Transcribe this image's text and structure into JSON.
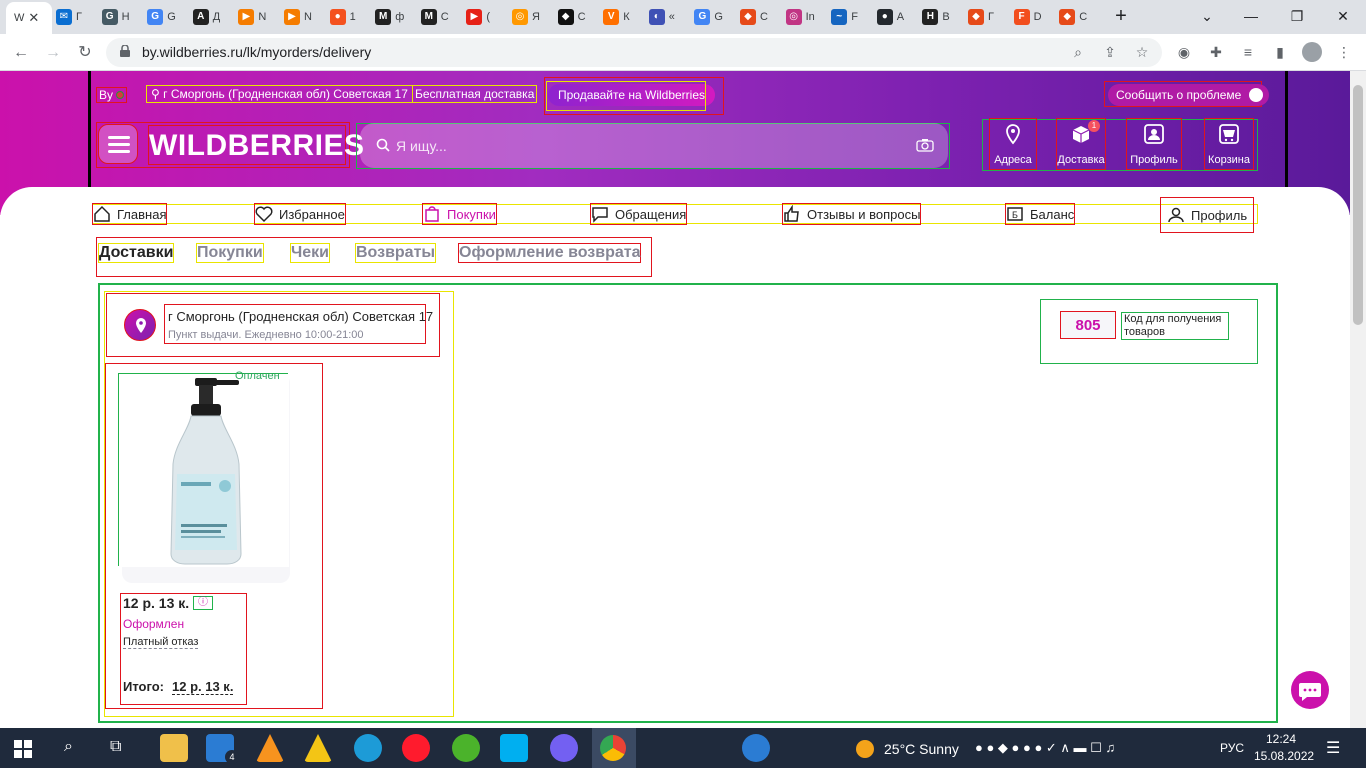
{
  "browser": {
    "tabs": [
      {
        "title": "W",
        "color": "#cb11ab",
        "glyph": "W"
      },
      {
        "title": "Г",
        "color": "#0a6ed1",
        "glyph": "✉"
      },
      {
        "title": "Н",
        "color": "#455a64",
        "glyph": "G"
      },
      {
        "title": "G",
        "color": "#4285f4",
        "glyph": "G"
      },
      {
        "title": "Д",
        "color": "#222222",
        "glyph": "A"
      },
      {
        "title": "N",
        "color": "#f57c00",
        "glyph": "▶"
      },
      {
        "title": "N",
        "color": "#f57c00",
        "glyph": "▶"
      },
      {
        "title": "1",
        "color": "#f4511e",
        "glyph": "●"
      },
      {
        "title": "ф",
        "color": "#222222",
        "glyph": "M"
      },
      {
        "title": "С",
        "color": "#222222",
        "glyph": "M"
      },
      {
        "title": "(",
        "color": "#e62117",
        "glyph": "▶"
      },
      {
        "title": "Я",
        "color": "#ff9800",
        "glyph": "◎"
      },
      {
        "title": "С",
        "color": "#111111",
        "glyph": "◆"
      },
      {
        "title": "К",
        "color": "#ff6f00",
        "glyph": "V"
      },
      {
        "title": "«",
        "color": "#3f51b5",
        "glyph": "◐"
      },
      {
        "title": "G",
        "color": "#4285f4",
        "glyph": "G"
      },
      {
        "title": "С",
        "color": "#e64a19",
        "glyph": "◆"
      },
      {
        "title": "In",
        "color": "#c13584",
        "glyph": "◎"
      },
      {
        "title": "F",
        "color": "#1565c0",
        "glyph": "~"
      },
      {
        "title": "A",
        "color": "#24292e",
        "glyph": "●"
      },
      {
        "title": "В",
        "color": "#222222",
        "glyph": "H"
      },
      {
        "title": "Г",
        "color": "#e64a19",
        "glyph": "◆"
      },
      {
        "title": "D",
        "color": "#f24e1e",
        "glyph": "F"
      },
      {
        "title": "С",
        "color": "#e64a19",
        "glyph": "◆"
      }
    ],
    "url": "by.wildberries.ru/lk/myorders/delivery"
  },
  "site": {
    "top": {
      "country": "By",
      "address": "г Сморгонь (Гродненская обл) Советская 17",
      "free_delivery": "Бесплатная доставка",
      "sell": "Продавайте на Wildberries",
      "report": "Сообщить о проблеме"
    },
    "logo": "WILDBERRIES",
    "search": {
      "placeholder": "Я ищу..."
    },
    "header_actions": [
      {
        "label": "Адреса",
        "icon": "map-pin-icon"
      },
      {
        "label": "Доставка",
        "icon": "box-icon",
        "badge": "1"
      },
      {
        "label": "Профиль",
        "icon": "profile-icon"
      },
      {
        "label": "Корзина",
        "icon": "cart-icon"
      }
    ],
    "profile_menu": [
      {
        "label": "Главная",
        "icon": "home-icon"
      },
      {
        "label": "Избранное",
        "icon": "heart-icon"
      },
      {
        "label": "Покупки",
        "icon": "bag-icon"
      },
      {
        "label": "Обращения",
        "icon": "chat-icon"
      },
      {
        "label": "Отзывы и вопросы",
        "icon": "thumbs-up-icon"
      },
      {
        "label": "Баланс",
        "icon": "wallet-icon"
      },
      {
        "label": "Профиль",
        "icon": "profile-icon"
      }
    ],
    "order_tabs": [
      "Доставки",
      "Покупки",
      "Чеки",
      "Возвраты",
      "Оформление возврата"
    ],
    "delivery": {
      "pickup_address": "г Сморгонь (Гродненская обл) Советская 17",
      "pickup_hours": "Пункт выдачи. Ежедневно 10:00-21:00",
      "code": "805",
      "code_label": "Код для получения товаров",
      "item": {
        "paid_label": "Оплачен",
        "price": "12 р. 13 к.",
        "status": "Оформлен",
        "refusal": "Платный отказ",
        "total_label": "Итого:",
        "total_value": "12 р. 13 к."
      }
    }
  },
  "taskbar": {
    "weather": "25°C  Sunny",
    "lang": "РУС",
    "time": "12:24",
    "date": "15.08.2022",
    "mail_badge": "4"
  }
}
